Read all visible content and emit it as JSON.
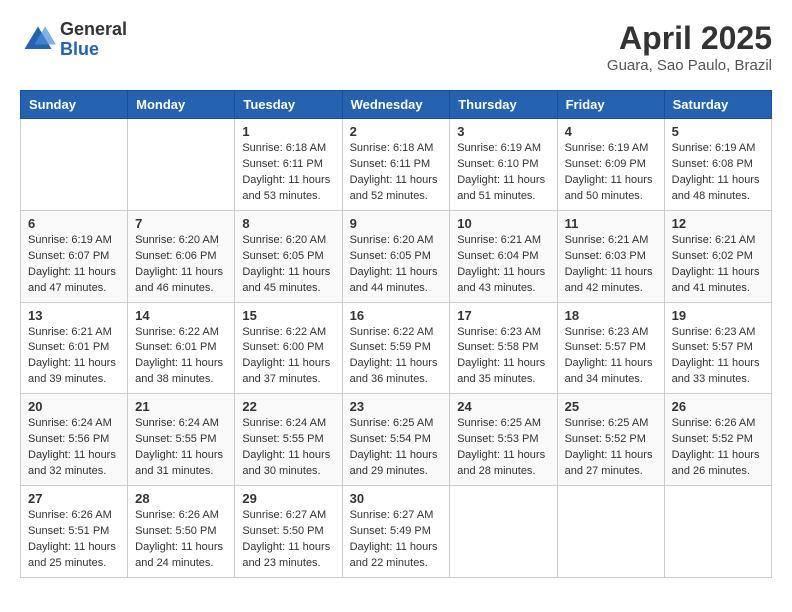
{
  "header": {
    "logo_general": "General",
    "logo_blue": "Blue",
    "month_title": "April 2025",
    "location": "Guara, Sao Paulo, Brazil"
  },
  "weekdays": [
    "Sunday",
    "Monday",
    "Tuesday",
    "Wednesday",
    "Thursday",
    "Friday",
    "Saturday"
  ],
  "weeks": [
    [
      {
        "day": null
      },
      {
        "day": null
      },
      {
        "day": "1",
        "sunrise": "Sunrise: 6:18 AM",
        "sunset": "Sunset: 6:11 PM",
        "daylight": "Daylight: 11 hours and 53 minutes."
      },
      {
        "day": "2",
        "sunrise": "Sunrise: 6:18 AM",
        "sunset": "Sunset: 6:11 PM",
        "daylight": "Daylight: 11 hours and 52 minutes."
      },
      {
        "day": "3",
        "sunrise": "Sunrise: 6:19 AM",
        "sunset": "Sunset: 6:10 PM",
        "daylight": "Daylight: 11 hours and 51 minutes."
      },
      {
        "day": "4",
        "sunrise": "Sunrise: 6:19 AM",
        "sunset": "Sunset: 6:09 PM",
        "daylight": "Daylight: 11 hours and 50 minutes."
      },
      {
        "day": "5",
        "sunrise": "Sunrise: 6:19 AM",
        "sunset": "Sunset: 6:08 PM",
        "daylight": "Daylight: 11 hours and 48 minutes."
      }
    ],
    [
      {
        "day": "6",
        "sunrise": "Sunrise: 6:19 AM",
        "sunset": "Sunset: 6:07 PM",
        "daylight": "Daylight: 11 hours and 47 minutes."
      },
      {
        "day": "7",
        "sunrise": "Sunrise: 6:20 AM",
        "sunset": "Sunset: 6:06 PM",
        "daylight": "Daylight: 11 hours and 46 minutes."
      },
      {
        "day": "8",
        "sunrise": "Sunrise: 6:20 AM",
        "sunset": "Sunset: 6:05 PM",
        "daylight": "Daylight: 11 hours and 45 minutes."
      },
      {
        "day": "9",
        "sunrise": "Sunrise: 6:20 AM",
        "sunset": "Sunset: 6:05 PM",
        "daylight": "Daylight: 11 hours and 44 minutes."
      },
      {
        "day": "10",
        "sunrise": "Sunrise: 6:21 AM",
        "sunset": "Sunset: 6:04 PM",
        "daylight": "Daylight: 11 hours and 43 minutes."
      },
      {
        "day": "11",
        "sunrise": "Sunrise: 6:21 AM",
        "sunset": "Sunset: 6:03 PM",
        "daylight": "Daylight: 11 hours and 42 minutes."
      },
      {
        "day": "12",
        "sunrise": "Sunrise: 6:21 AM",
        "sunset": "Sunset: 6:02 PM",
        "daylight": "Daylight: 11 hours and 41 minutes."
      }
    ],
    [
      {
        "day": "13",
        "sunrise": "Sunrise: 6:21 AM",
        "sunset": "Sunset: 6:01 PM",
        "daylight": "Daylight: 11 hours and 39 minutes."
      },
      {
        "day": "14",
        "sunrise": "Sunrise: 6:22 AM",
        "sunset": "Sunset: 6:01 PM",
        "daylight": "Daylight: 11 hours and 38 minutes."
      },
      {
        "day": "15",
        "sunrise": "Sunrise: 6:22 AM",
        "sunset": "Sunset: 6:00 PM",
        "daylight": "Daylight: 11 hours and 37 minutes."
      },
      {
        "day": "16",
        "sunrise": "Sunrise: 6:22 AM",
        "sunset": "Sunset: 5:59 PM",
        "daylight": "Daylight: 11 hours and 36 minutes."
      },
      {
        "day": "17",
        "sunrise": "Sunrise: 6:23 AM",
        "sunset": "Sunset: 5:58 PM",
        "daylight": "Daylight: 11 hours and 35 minutes."
      },
      {
        "day": "18",
        "sunrise": "Sunrise: 6:23 AM",
        "sunset": "Sunset: 5:57 PM",
        "daylight": "Daylight: 11 hours and 34 minutes."
      },
      {
        "day": "19",
        "sunrise": "Sunrise: 6:23 AM",
        "sunset": "Sunset: 5:57 PM",
        "daylight": "Daylight: 11 hours and 33 minutes."
      }
    ],
    [
      {
        "day": "20",
        "sunrise": "Sunrise: 6:24 AM",
        "sunset": "Sunset: 5:56 PM",
        "daylight": "Daylight: 11 hours and 32 minutes."
      },
      {
        "day": "21",
        "sunrise": "Sunrise: 6:24 AM",
        "sunset": "Sunset: 5:55 PM",
        "daylight": "Daylight: 11 hours and 31 minutes."
      },
      {
        "day": "22",
        "sunrise": "Sunrise: 6:24 AM",
        "sunset": "Sunset: 5:55 PM",
        "daylight": "Daylight: 11 hours and 30 minutes."
      },
      {
        "day": "23",
        "sunrise": "Sunrise: 6:25 AM",
        "sunset": "Sunset: 5:54 PM",
        "daylight": "Daylight: 11 hours and 29 minutes."
      },
      {
        "day": "24",
        "sunrise": "Sunrise: 6:25 AM",
        "sunset": "Sunset: 5:53 PM",
        "daylight": "Daylight: 11 hours and 28 minutes."
      },
      {
        "day": "25",
        "sunrise": "Sunrise: 6:25 AM",
        "sunset": "Sunset: 5:52 PM",
        "daylight": "Daylight: 11 hours and 27 minutes."
      },
      {
        "day": "26",
        "sunrise": "Sunrise: 6:26 AM",
        "sunset": "Sunset: 5:52 PM",
        "daylight": "Daylight: 11 hours and 26 minutes."
      }
    ],
    [
      {
        "day": "27",
        "sunrise": "Sunrise: 6:26 AM",
        "sunset": "Sunset: 5:51 PM",
        "daylight": "Daylight: 11 hours and 25 minutes."
      },
      {
        "day": "28",
        "sunrise": "Sunrise: 6:26 AM",
        "sunset": "Sunset: 5:50 PM",
        "daylight": "Daylight: 11 hours and 24 minutes."
      },
      {
        "day": "29",
        "sunrise": "Sunrise: 6:27 AM",
        "sunset": "Sunset: 5:50 PM",
        "daylight": "Daylight: 11 hours and 23 minutes."
      },
      {
        "day": "30",
        "sunrise": "Sunrise: 6:27 AM",
        "sunset": "Sunset: 5:49 PM",
        "daylight": "Daylight: 11 hours and 22 minutes."
      },
      {
        "day": null
      },
      {
        "day": null
      },
      {
        "day": null
      }
    ]
  ]
}
